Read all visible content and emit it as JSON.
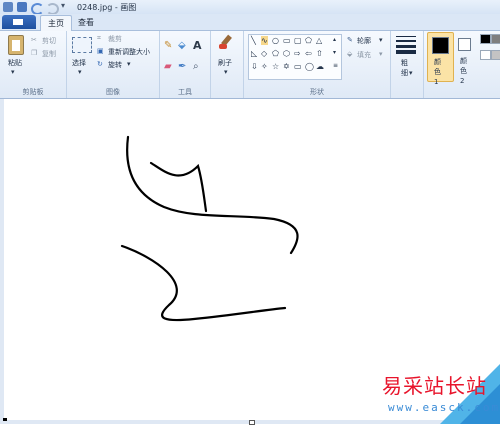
{
  "window": {
    "title": "0248.jpg - 画图"
  },
  "tabs": [
    {
      "label": "主页",
      "active": true
    },
    {
      "label": "查看",
      "active": false
    }
  ],
  "clipboard": {
    "paste_label": "粘贴",
    "cut_label": "剪切",
    "copy_label": "复制",
    "group_label": "剪贴板"
  },
  "image": {
    "select_label": "选择",
    "crop_label": "裁剪",
    "resize_label": "重新调整大小",
    "rotate_label": "旋转",
    "group_label": "图像"
  },
  "tools": {
    "group_label": "工具"
  },
  "brushes": {
    "label": "刷子"
  },
  "shapes": {
    "outline_label": "轮廓",
    "fill_label": "填充",
    "group_label": "形状"
  },
  "size": {
    "label": "粗细"
  },
  "colors": {
    "color1_label": "颜色 1",
    "color2_label": "颜色 2",
    "color1_value": "#000000",
    "color2_value": "#ffffff",
    "palette": [
      "#000000",
      "#7f7f7f",
      "#ffffff",
      "#c3c3c3"
    ]
  },
  "watermark": {
    "text": "易采站长站",
    "url": "www.easck.com"
  }
}
